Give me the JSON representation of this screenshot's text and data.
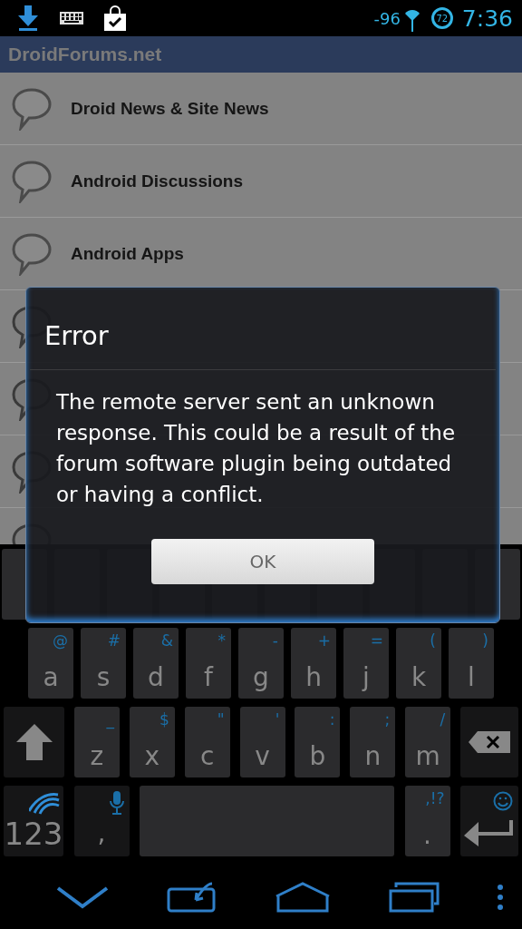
{
  "status_bar": {
    "signal_reading": "-96",
    "badge": "72",
    "time": "7:36"
  },
  "action_bar": {
    "title": "DroidForums.net"
  },
  "list": {
    "items": [
      {
        "title": "Droid News & Site News"
      },
      {
        "title": "Android Discussions"
      },
      {
        "title": "Android Apps"
      }
    ]
  },
  "dialog": {
    "title": "Error",
    "message": "The remote server sent an unknown response. This could be a result of the forum software plugin being outdated or having a conflict.",
    "button": "OK"
  },
  "keyboard": {
    "rows": [
      [
        {
          "kind": "char",
          "label": "a",
          "alt": "@"
        },
        {
          "kind": "char",
          "label": "s",
          "alt": "#"
        },
        {
          "kind": "char",
          "label": "d",
          "alt": "&"
        },
        {
          "kind": "char",
          "label": "f",
          "alt": "*"
        },
        {
          "kind": "char",
          "label": "g",
          "alt": "-"
        },
        {
          "kind": "char",
          "label": "h",
          "alt": "+"
        },
        {
          "kind": "char",
          "label": "j",
          "alt": "="
        },
        {
          "kind": "char",
          "label": "k",
          "alt": "("
        },
        {
          "kind": "char",
          "label": "l",
          "alt": ")"
        }
      ],
      [
        {
          "kind": "shift"
        },
        {
          "kind": "char",
          "label": "z",
          "alt": "_"
        },
        {
          "kind": "char",
          "label": "x",
          "alt": "$"
        },
        {
          "kind": "char",
          "label": "c",
          "alt": "\""
        },
        {
          "kind": "char",
          "label": "v",
          "alt": "'"
        },
        {
          "kind": "char",
          "label": "b",
          "alt": ":"
        },
        {
          "kind": "char",
          "label": "n",
          "alt": ";"
        },
        {
          "kind": "char",
          "label": "m",
          "alt": "/"
        },
        {
          "kind": "backspace"
        }
      ],
      [
        {
          "kind": "symbols",
          "label": "123"
        },
        {
          "kind": "voice",
          "label": ","
        },
        {
          "kind": "space"
        },
        {
          "kind": "char",
          "label": ".",
          "alt": ",!?"
        },
        {
          "kind": "enter"
        }
      ]
    ]
  }
}
